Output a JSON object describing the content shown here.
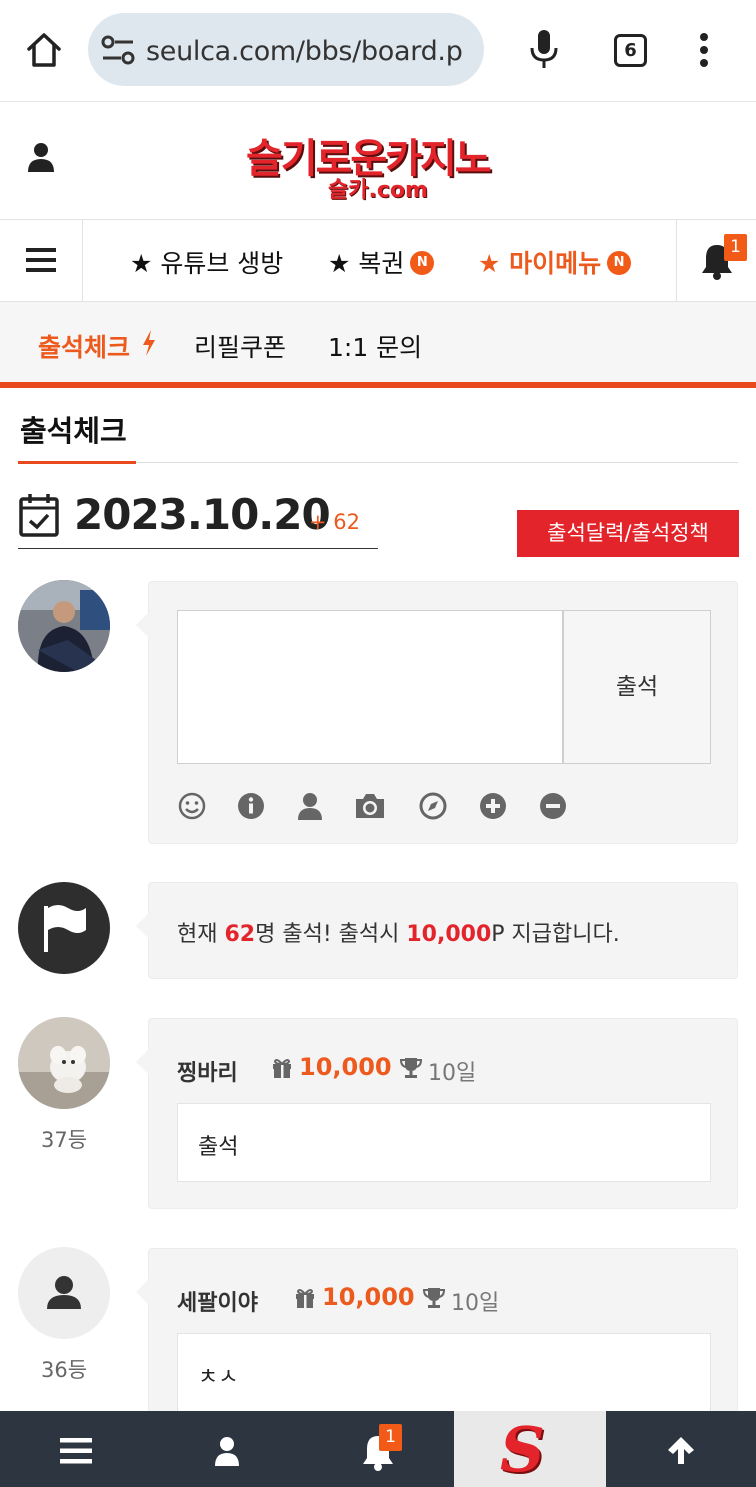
{
  "browser": {
    "url": "seulca.com/bbs/board.p",
    "tab_count": "6"
  },
  "header": {
    "logo_main": "슬기로운카지노",
    "logo_sub": "슬카.com"
  },
  "nav": {
    "items": [
      {
        "label": "★ 유튜브 생방",
        "badge": ""
      },
      {
        "label": "★ 복권",
        "badge": "N"
      },
      {
        "label": "★ 마이메뉴",
        "badge": "N"
      }
    ],
    "notification_count": "1"
  },
  "sub_nav": {
    "items": [
      "출석체크",
      "리필쿠폰",
      "1:1 문의"
    ]
  },
  "page": {
    "title": "출석체크",
    "date": "2023.10.20",
    "date_count": "+ 62",
    "calendar_button": "출석달력/출석정책"
  },
  "comment_form": {
    "submit_label": "출석",
    "tools": [
      "smile-icon",
      "info-icon",
      "user-icon",
      "camera-icon",
      "compass-icon",
      "plus-circle-icon",
      "minus-circle-icon"
    ]
  },
  "notice": {
    "prefix": "현재 ",
    "count": "62",
    "mid": "명 출석! 출석시 ",
    "points": "10,000",
    "suffix": "P 지급합니다."
  },
  "entries": [
    {
      "username": "찡바리",
      "points": "10,000",
      "days": "10일",
      "message": "출석",
      "rank": "37등"
    },
    {
      "username": "세팔이야",
      "points": "10,000",
      "days": "10일",
      "message": "ㅊㅅ",
      "rank": "36등"
    }
  ],
  "bottom_bar": {
    "notification_count": "1",
    "logo_letter": "S"
  },
  "colors": {
    "accent": "#ec5a1e",
    "brand_red": "#e3242b",
    "bottom_bar": "#2c3540"
  }
}
